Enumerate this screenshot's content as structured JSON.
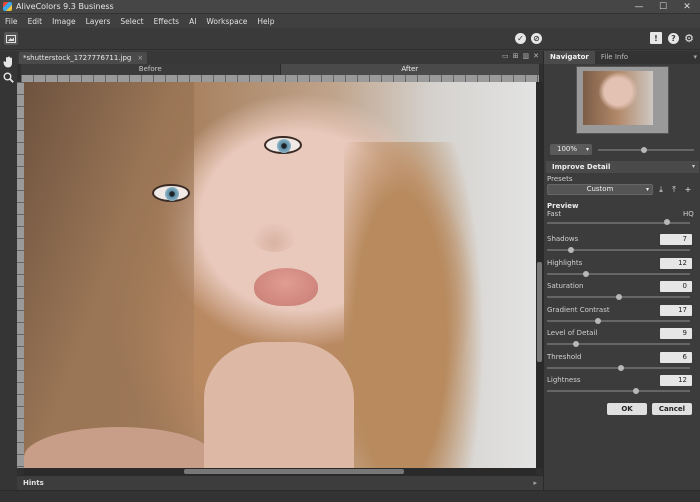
{
  "window": {
    "title": "AliveColors 9.3 Business",
    "minimize": "—",
    "maximize": "☐",
    "close": "✕"
  },
  "menu": [
    "File",
    "Edit",
    "Image",
    "Layers",
    "Select",
    "Effects",
    "AI",
    "Workspace",
    "Help"
  ],
  "toolbar": {
    "apply_icon": "checkmark-icon",
    "cancel_icon": "cancel-icon",
    "notifications_icon": "notification-icon",
    "help_icon": "help-icon",
    "settings_icon": "gear-icon"
  },
  "document": {
    "tab_name": "*shutterstock_1727776711.jpg",
    "tab_close": "×",
    "before_label": "Before",
    "after_label": "After",
    "hints_label": "Hints"
  },
  "panel": {
    "tabs": [
      "Navigator",
      "File Info"
    ],
    "zoom": "100%",
    "zoom_level": 1.0,
    "section_title": "Improve Detail",
    "presets_label": "Presets",
    "preset_value": "Custom",
    "preview_label": "Preview",
    "preview_fast": "Fast",
    "preview_hq": "HQ",
    "preview_level": 0.84,
    "params": [
      {
        "label": "Shadows",
        "value": "7",
        "level": 0.17
      },
      {
        "label": "Highlights",
        "value": "12",
        "level": 0.27
      },
      {
        "label": "Saturation",
        "value": "0",
        "level": 0.5
      },
      {
        "label": "Gradient Contrast",
        "value": "17",
        "level": 0.36
      },
      {
        "label": "Level of Detail",
        "value": "9",
        "level": 0.2
      },
      {
        "label": "Threshold",
        "value": "6",
        "level": 0.52
      },
      {
        "label": "Lightness",
        "value": "12",
        "level": 0.62
      }
    ],
    "ok_label": "OK",
    "cancel_label": "Cancel"
  }
}
